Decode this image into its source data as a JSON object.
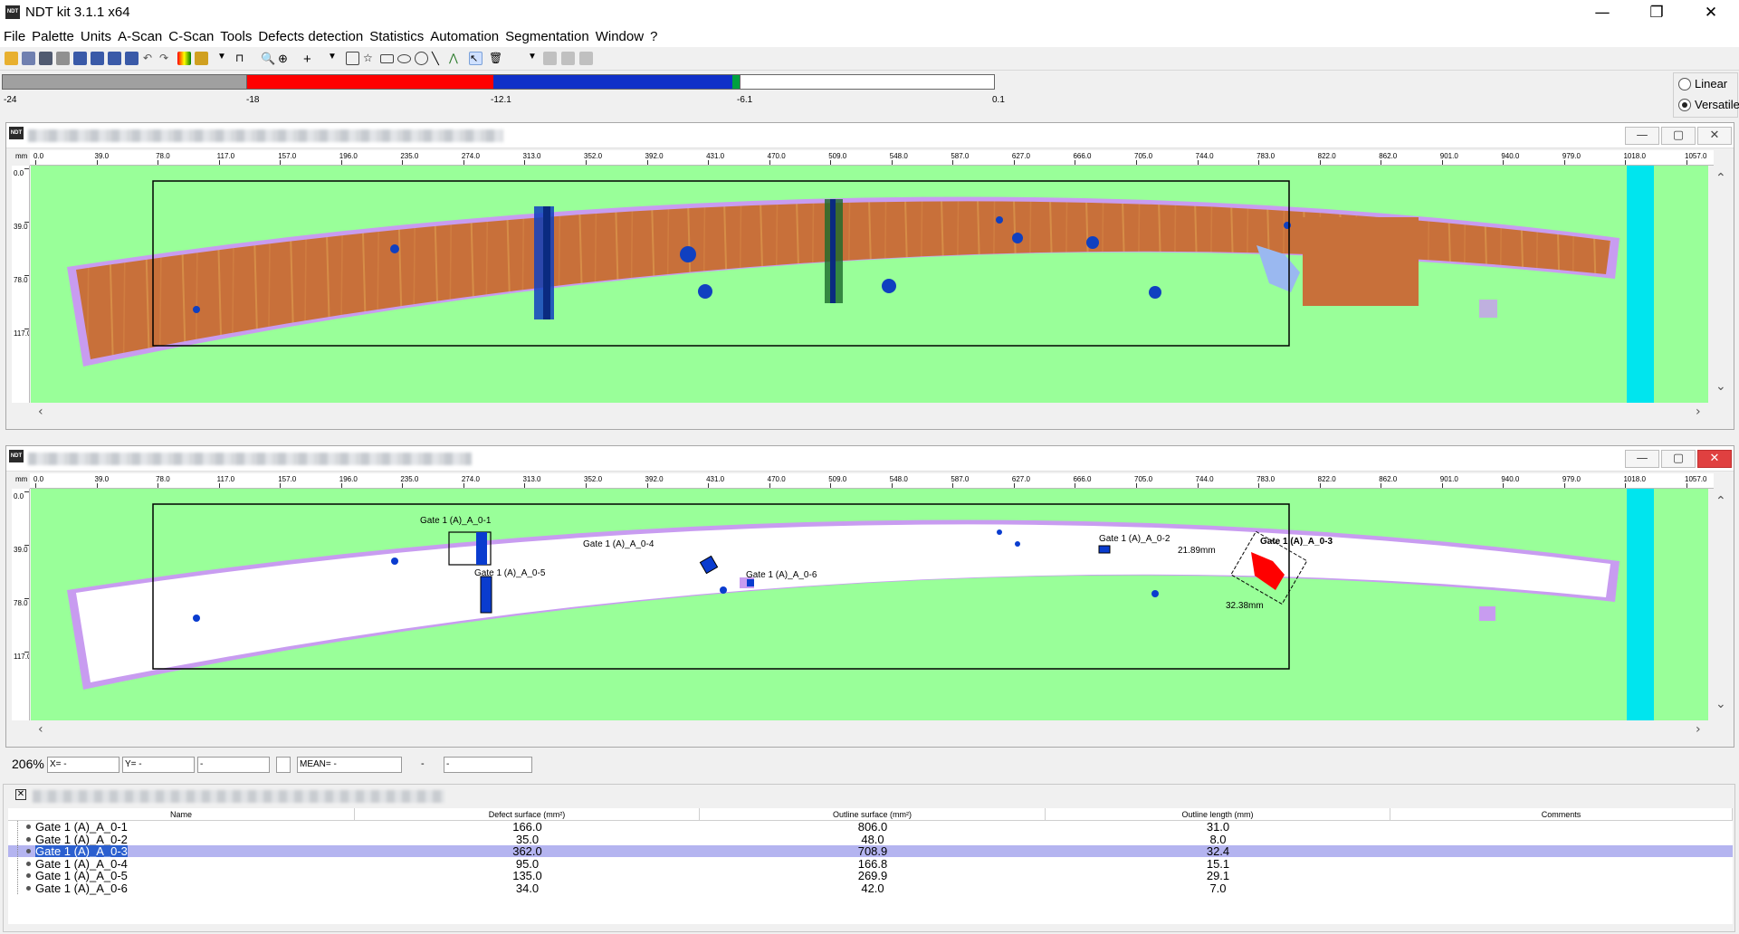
{
  "app": {
    "title": "NDT kit 3.1.1 x64",
    "logo_text": "NDT"
  },
  "menu": [
    "File",
    "Palette",
    "Units",
    "A-Scan",
    "C-Scan",
    "Tools",
    "Defects detection",
    "Statistics",
    "Automation",
    "Segmentation",
    "Window",
    "?"
  ],
  "palette": {
    "ticks": [
      "-24",
      "-18",
      "-12.1",
      "-6.1",
      "0.1"
    ],
    "colors": {
      "gray": "#a0a0a0",
      "red": "#ff0000",
      "blue": "#1030c8",
      "green": "#00a040",
      "white": "#ffffff"
    },
    "modes": [
      {
        "label": "Linear",
        "selected": false
      },
      {
        "label": "Versatile",
        "selected": true
      }
    ]
  },
  "ruler": {
    "unit": "mm",
    "x_ticks": [
      "0.0",
      "39.0",
      "78.0",
      "117.0",
      "157.0",
      "196.0",
      "235.0",
      "274.0",
      "313.0",
      "352.0",
      "392.0",
      "431.0",
      "470.0",
      "509.0",
      "548.0",
      "587.0",
      "627.0",
      "666.0",
      "705.0",
      "744.0",
      "783.0",
      "822.0",
      "862.0",
      "901.0",
      "940.0",
      "979.0",
      "1018.0",
      "1057.0"
    ],
    "y_ticks": [
      "0.0",
      "39.0",
      "78.0",
      "117.0"
    ]
  },
  "top_view": {
    "colors": {
      "background": "#99ff99",
      "part": "#c8703a",
      "outline": "#c89cf0",
      "edge": "#00e5ee"
    }
  },
  "bottom_view": {
    "colors": {
      "background": "#99ff99",
      "part": "#ffffff",
      "defect": "#0a3ccf",
      "selected_defect": "#ff0000"
    },
    "defect_labels": [
      "Gate 1 (A)_A_0-1",
      "Gate 1 (A)_A_0-5",
      "Gate 1 (A)_A_0-4",
      "Gate 1 (A)_A_0-6",
      "Gate 1 (A)_A_0-2",
      "Gate 1 (A)_A_0-3"
    ],
    "measurements": {
      "width": "21.89mm",
      "length": "32.38mm"
    }
  },
  "status": {
    "zoom": "206%",
    "x": "X= -",
    "y": "Y= -",
    "value": "-",
    "mean": "MEAN= -",
    "dash": "-",
    "result": "-"
  },
  "table": {
    "columns": [
      "Name",
      "Defect surface (mm²)",
      "Outline surface (mm²)",
      "Outline length (mm)",
      "Comments"
    ],
    "rows": [
      {
        "name": "Gate 1 (A)_A_0-1",
        "defect": "166.0",
        "outline": "806.0",
        "length": "31.0",
        "comments": ""
      },
      {
        "name": "Gate 1 (A)_A_0-2",
        "defect": "35.0",
        "outline": "48.0",
        "length": "8.0",
        "comments": ""
      },
      {
        "name": "Gate 1 (A)_A_0-3",
        "defect": "362.0",
        "outline": "708.9",
        "length": "32.4",
        "comments": "",
        "selected": true
      },
      {
        "name": "Gate 1 (A)_A_0-4",
        "defect": "95.0",
        "outline": "166.8",
        "length": "15.1",
        "comments": ""
      },
      {
        "name": "Gate 1 (A)_A_0-5",
        "defect": "135.0",
        "outline": "269.9",
        "length": "29.1",
        "comments": ""
      },
      {
        "name": "Gate 1 (A)_A_0-6",
        "defect": "34.0",
        "outline": "42.0",
        "length": "7.0",
        "comments": ""
      }
    ]
  }
}
